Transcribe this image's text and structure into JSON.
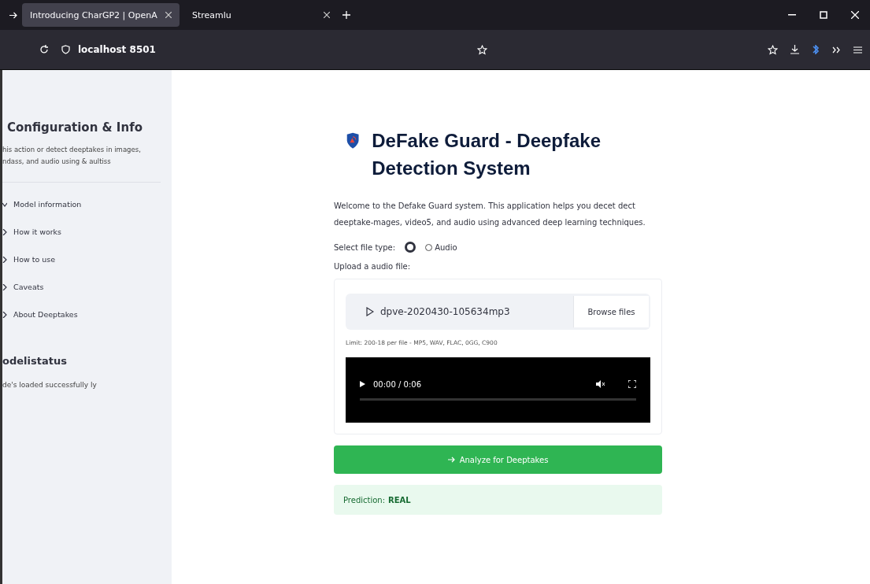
{
  "browser": {
    "tabs": [
      {
        "title": "Introducing CharGP2 | OpenA",
        "selected": true
      },
      {
        "title": "Streamlu",
        "selected": false
      }
    ],
    "address": "localhost 8501"
  },
  "sidebar": {
    "title": "Configuration & Info",
    "description": "his action or detect deeptakes in images, ndass, and audio using & aultiss",
    "items": [
      {
        "label": "Model information",
        "expanded": true
      },
      {
        "label": "How it works",
        "expanded": false
      },
      {
        "label": "How to use",
        "expanded": false
      },
      {
        "label": "Caveats",
        "expanded": false
      },
      {
        "label": "About Deeptakes",
        "expanded": false
      }
    ],
    "status_title": "odelistatus",
    "status_text": "de's loaded successfully ly"
  },
  "main": {
    "title": "DeFake Guard - Deepfake Detection System",
    "intro": "Welcome to the Defake Guard system. This application helps you decet dect deeptake-mages, video5, and audio using advanced deep learning techniques.",
    "file_type_label": "Select file type:",
    "file_types": [
      {
        "selected": true
      },
      {
        "label": "Audio",
        "selected": false
      }
    ],
    "upload_label": "Upload a audio file:",
    "file_name": "dpve-2020430-105634mp3",
    "browse_button": "Browse files",
    "limit": "Limit: 200-18 per file - MP5, WAV, FLAC, 0GG, C900",
    "player_time": "00:00 / 0:06",
    "analyze_button": "Analyze for Deeptakes",
    "prediction_label": "Prediction:",
    "prediction_value": "REAL"
  }
}
